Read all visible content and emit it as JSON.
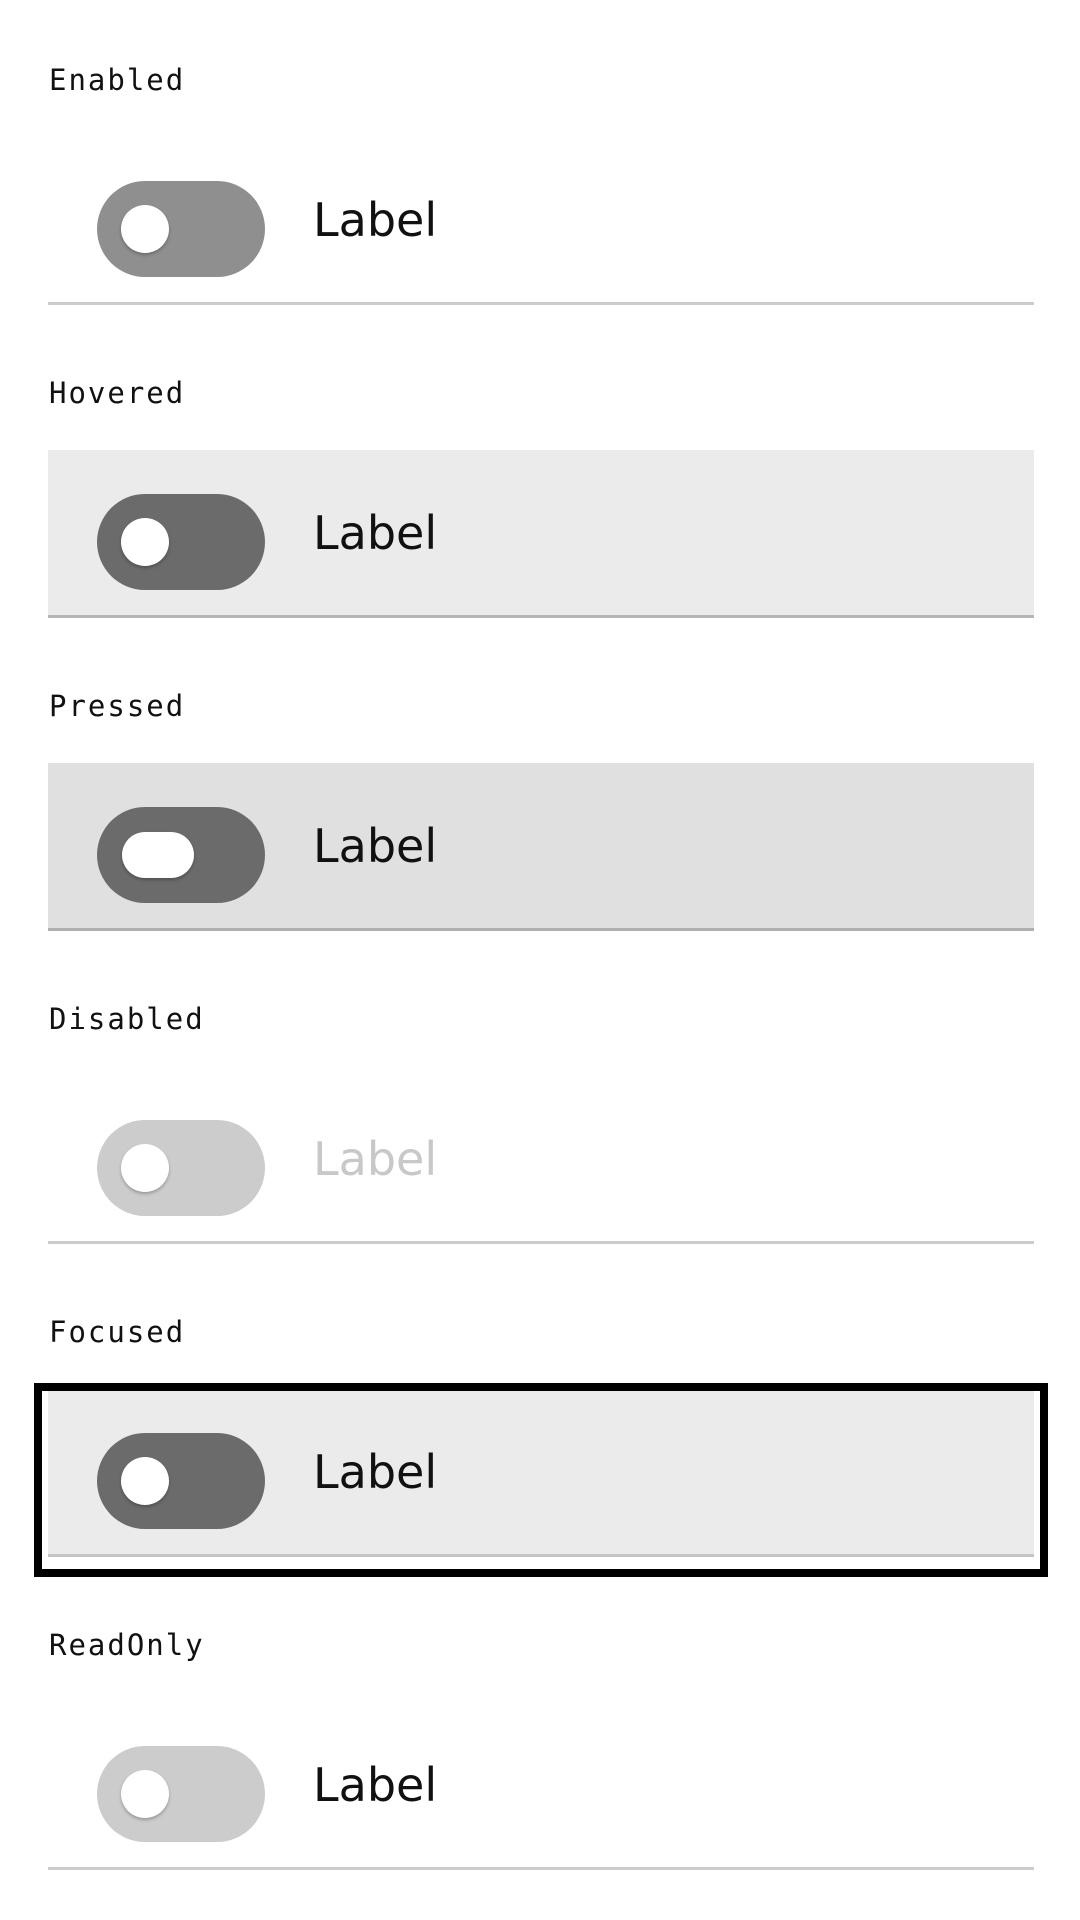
{
  "states": [
    {
      "heading": "Enabled",
      "label": "Label"
    },
    {
      "heading": "Hovered",
      "label": "Label"
    },
    {
      "heading": "Pressed",
      "label": "Label"
    },
    {
      "heading": "Disabled",
      "label": "Label"
    },
    {
      "heading": "Focused",
      "label": "Label"
    },
    {
      "heading": "ReadOnly",
      "label": "Label"
    }
  ],
  "toggle_checked": false,
  "colors": {
    "track_enabled": "#8f8f8f",
    "track_active": "#6b6b6b",
    "track_disabled": "#cccccc",
    "row_hovered": "#ebebeb",
    "row_pressed": "#e0e0e0",
    "focus_ring": "#000000",
    "label_disabled": "#c8c8c8"
  }
}
